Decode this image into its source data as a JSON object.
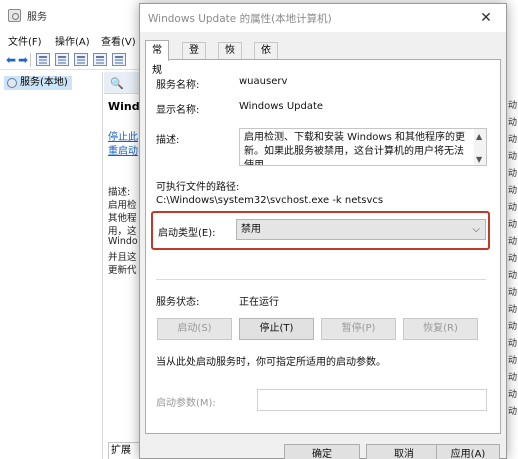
{
  "background_window": {
    "title": "服务",
    "menu": [
      "文件(F)",
      "操作(A)",
      "查看(V)"
    ],
    "tree_item": "服务(本地)",
    "detail": {
      "title": "Windo",
      "link_stop": "停止此",
      "link_restart": "重启动",
      "desc_lines": [
        "描述:",
        "启用检",
        "其他程",
        "用，这",
        "Windo",
        "并且这",
        "更新代"
      ],
      "tab_label": "扩展"
    },
    "list_strip_cells": [
      "动",
      "动",
      "动",
      "动",
      "动",
      "动",
      "动",
      "动",
      "动",
      "动",
      "动",
      "动",
      "动",
      "动",
      "动",
      "动",
      "动",
      "动",
      "动"
    ]
  },
  "dialog": {
    "title": "Windows Update 的属性(本地计算机)",
    "close_symbol": "✕",
    "tabs": [
      "常规",
      "登录",
      "恢复",
      "依存关系"
    ],
    "general": {
      "service_name_label": "服务名称:",
      "service_name_value": "wuauserv",
      "display_name_label": "显示名称:",
      "display_name_value": "Windows Update",
      "description_label": "描述:",
      "description_value": "启用检测、下载和安装 Windows 和其他程序的更新。如果此服务被禁用，这台计算机的用户将无法使用",
      "exec_path_label": "可执行文件的路径:",
      "exec_path_value": "C:\\Windows\\system32\\svchost.exe -k netsvcs",
      "startup_type_label": "启动类型(E):",
      "startup_type_value": "禁用",
      "service_status_label": "服务状态:",
      "service_status_value": "正在运行",
      "buttons": {
        "start": "启动(S)",
        "stop": "停止(T)",
        "pause": "暂停(P)",
        "resume": "恢复(R)"
      },
      "hint_text": "当从此处启动服务时，你可指定所适用的启动参数。",
      "start_params_label": "启动参数(M):"
    },
    "footer": {
      "ok": "确定",
      "cancel": "取消",
      "apply": "应用(A)"
    }
  },
  "colors": {
    "highlight_border": "#c0392b",
    "link": "#1a5fc4",
    "selection": "#cce4f7"
  }
}
